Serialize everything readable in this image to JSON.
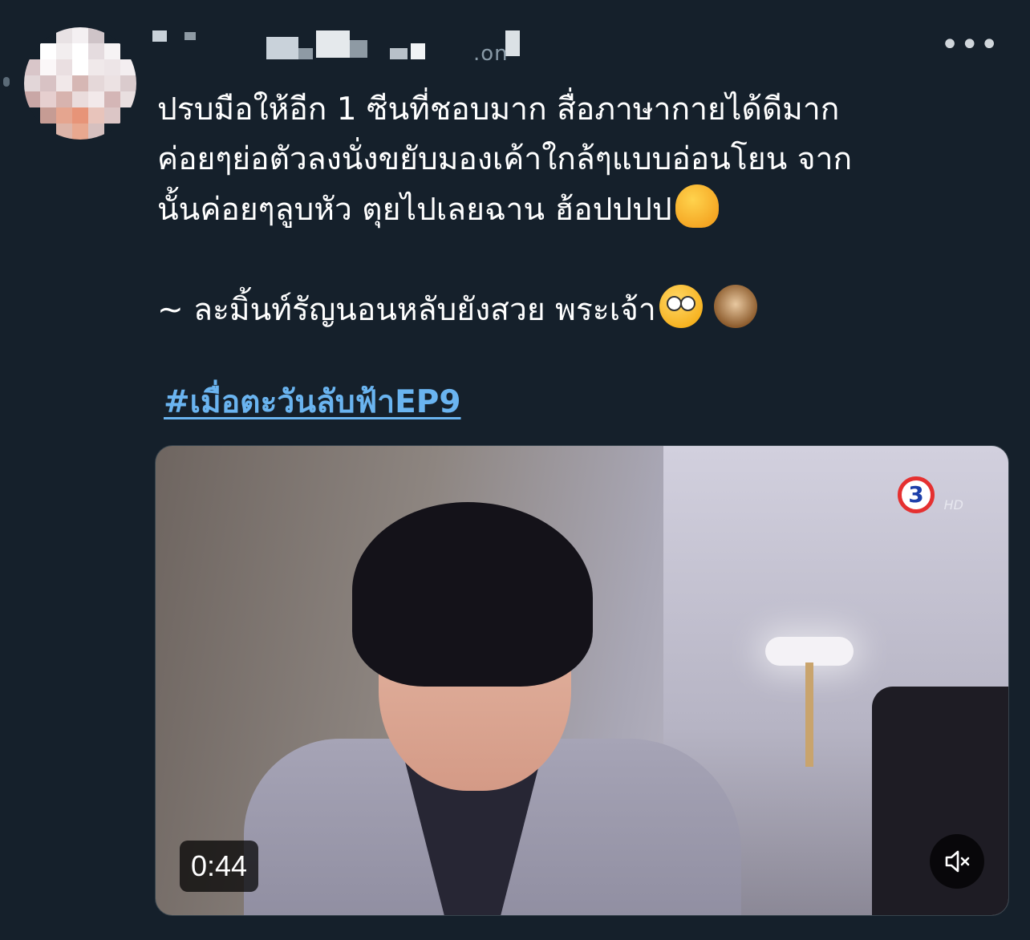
{
  "tweet": {
    "more_label": "•••",
    "author_visible_fragment": ".on",
    "lines": [
      "ปรบมือให้อีก 1 ซีนที่ชอบมาก สื่อภาษากายได้ดีมาก",
      "ค่อยๆย่อตัวลงนั่งขยับมองเค้าใกล้ๆแบบอ่อนโยน จาก",
      "นั้นค่อยๆลูบหัว ตุยไปเลยฉาน ฮ้อปปปป"
    ],
    "line4": "~ ละมิ้นท์รัญนอนหลับยังสวย พระเจ้า",
    "emojis": [
      "melting-face",
      "flushed-face",
      "see-no-evil-monkey"
    ],
    "hashtag": "#เมื่อตะวันลับฟ้าEP9"
  },
  "video": {
    "duration": "0:44",
    "channel_number": "3",
    "channel_quality": "HD",
    "muted": true
  },
  "colors": {
    "background": "#15202b",
    "link": "#6ab4f0",
    "text": "#ffffff"
  }
}
